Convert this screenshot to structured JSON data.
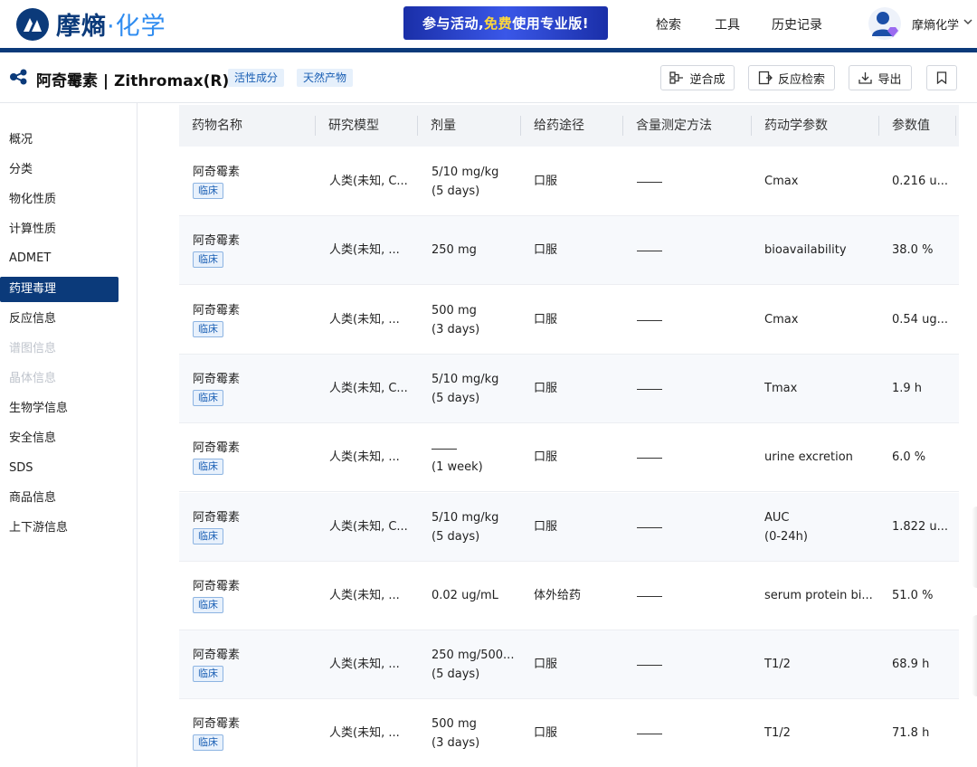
{
  "brand": {
    "name_main": "摩熵",
    "name_accent": "化学",
    "separator": "·"
  },
  "promo": {
    "prefix": "参与活动,",
    "highlight": "免费",
    "suffix": "使用专业版!"
  },
  "nav": {
    "search": "检索",
    "tools": "工具",
    "history": "历史记录"
  },
  "user": {
    "name": "摩熵化学"
  },
  "compound": {
    "title": "阿奇霉素 | Zithromax(R)",
    "tags": [
      "活性成分",
      "天然产物"
    ],
    "actions": {
      "retrosynthesis": "逆合成",
      "reaction_search": "反应检索",
      "export": "导出"
    }
  },
  "sidebar": {
    "items": [
      {
        "label": "概况",
        "state": "normal"
      },
      {
        "label": "分类",
        "state": "normal"
      },
      {
        "label": "物化性质",
        "state": "normal"
      },
      {
        "label": "计算性质",
        "state": "normal"
      },
      {
        "label": "ADMET",
        "state": "normal"
      },
      {
        "label": "药理毒理",
        "state": "active"
      },
      {
        "label": "反应信息",
        "state": "normal"
      },
      {
        "label": "谱图信息",
        "state": "disabled"
      },
      {
        "label": "晶体信息",
        "state": "disabled"
      },
      {
        "label": "生物学信息",
        "state": "normal"
      },
      {
        "label": "安全信息",
        "state": "normal"
      },
      {
        "label": "SDS",
        "state": "normal"
      },
      {
        "label": "商品信息",
        "state": "normal"
      },
      {
        "label": "上下游信息",
        "state": "normal"
      }
    ]
  },
  "table": {
    "columns": [
      "药物名称",
      "研究模型",
      "剂量",
      "给药途径",
      "含量测定方法",
      "药动学参数",
      "参数值"
    ],
    "rows": [
      {
        "drug": "阿奇霉素",
        "badge": "临床",
        "model": "人类(未知, C...",
        "dose1": "5/10 mg/kg",
        "dose2": "(5 days)",
        "route": "口服",
        "method": "——",
        "param1": "Cmax",
        "param2": "",
        "value": "0.216 u..."
      },
      {
        "drug": "阿奇霉素",
        "badge": "临床",
        "model": "人类(未知, ...",
        "dose1": "250 mg",
        "dose2": "",
        "route": "口服",
        "method": "——",
        "param1": "bioavailability",
        "param2": "",
        "value": "38.0 %"
      },
      {
        "drug": "阿奇霉素",
        "badge": "临床",
        "model": "人类(未知, ...",
        "dose1": "500 mg",
        "dose2": "(3 days)",
        "route": "口服",
        "method": "——",
        "param1": "Cmax",
        "param2": "",
        "value": "0.54 ug..."
      },
      {
        "drug": "阿奇霉素",
        "badge": "临床",
        "model": "人类(未知, C...",
        "dose1": "5/10 mg/kg",
        "dose2": "(5 days)",
        "route": "口服",
        "method": "——",
        "param1": "Tmax",
        "param2": "",
        "value": "1.9 h"
      },
      {
        "drug": "阿奇霉素",
        "badge": "临床",
        "model": "人类(未知, ...",
        "dose1": "——",
        "dose2": "(1 week)",
        "route": "口服",
        "method": "——",
        "param1": "urine excretion",
        "param2": "",
        "value": "6.0 %"
      },
      {
        "drug": "阿奇霉素",
        "badge": "临床",
        "model": "人类(未知, C...",
        "dose1": "5/10 mg/kg",
        "dose2": "(5 days)",
        "route": "口服",
        "method": "——",
        "param1": "AUC",
        "param2": "(0-24h)",
        "value": "1.822 u..."
      },
      {
        "drug": "阿奇霉素",
        "badge": "临床",
        "model": "人类(未知, ...",
        "dose1": "0.02 ug/mL",
        "dose2": "",
        "route": "体外给药",
        "method": "——",
        "param1": "serum protein bi...",
        "param2": "",
        "value": "51.0 %"
      },
      {
        "drug": "阿奇霉素",
        "badge": "临床",
        "model": "人类(未知, ...",
        "dose1": "250 mg/500...",
        "dose2": "(5 days)",
        "route": "口服",
        "method": "——",
        "param1": "T1/2",
        "param2": "",
        "value": "68.9 h"
      },
      {
        "drug": "阿奇霉素",
        "badge": "临床",
        "model": "人类(未知, ...",
        "dose1": "500 mg",
        "dose2": "(3 days)",
        "route": "口服",
        "method": "——",
        "param1": "T1/2",
        "param2": "",
        "value": "71.8 h"
      }
    ]
  },
  "colors": {
    "brand_navy": "#0b3a7a",
    "accent_blue": "#2f8cf0",
    "promo_highlight": "#ffd83a",
    "tag_bg": "#e6f0fb"
  }
}
